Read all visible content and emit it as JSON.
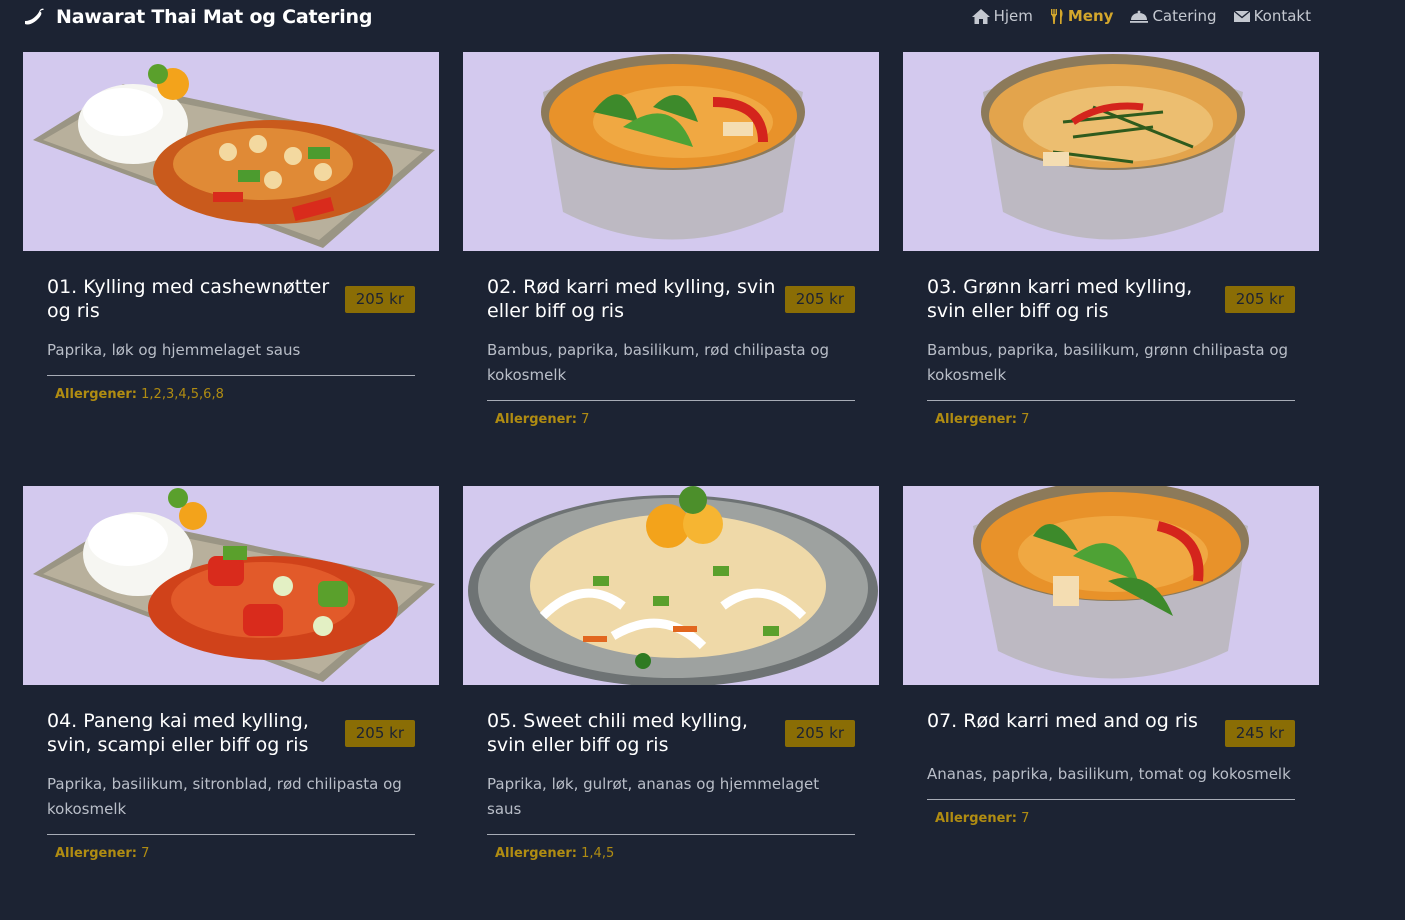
{
  "brand": {
    "name": "Nawarat Thai Mat og Catering",
    "icon": "chili-pepper-icon"
  },
  "nav": [
    {
      "label": "Hjem",
      "icon": "home-icon",
      "active": false
    },
    {
      "label": "Meny",
      "icon": "utensils-icon",
      "active": true
    },
    {
      "label": "Catering",
      "icon": "cloche-icon",
      "active": false
    },
    {
      "label": "Kontakt",
      "icon": "envelope-icon",
      "active": false
    }
  ],
  "allergen_label": "Allergener:",
  "colors": {
    "background": "#1c2333",
    "accent": "#d4a72c",
    "badge": "#8a6d05"
  },
  "menu": [
    {
      "name": "01. Kylling med cashewnøtter og ris",
      "price": "205 kr",
      "description": "Paprika, løk og hjemmelaget saus",
      "allergens": "1,2,3,4,5,6,8",
      "photo": "plate-with-rice-and-cashew-chicken"
    },
    {
      "name": "02. Rød karri med kylling, svin eller biff og ris",
      "price": "205 kr",
      "description": "Bambus, paprika, basilikum, rød chilipasta og kokosmelk",
      "allergens": "7",
      "photo": "bowl-of-red-curry"
    },
    {
      "name": "03. Grønn karri med kylling, svin eller biff og ris",
      "price": "205 kr",
      "description": "Bambus, paprika, basilikum, grønn chilipasta og kokosmelk",
      "allergens": "7",
      "photo": "bowl-of-green-curry"
    },
    {
      "name": "04. Paneng kai med kylling, svin, scampi eller biff og ris",
      "price": "205 kr",
      "description": "Paprika, basilikum, sitronblad, rød chilipasta og kokosmelk",
      "allergens": "7",
      "photo": "plate-with-rice-and-paneng-curry"
    },
    {
      "name": "05. Sweet chili med kylling, svin eller biff og ris",
      "price": "205 kr",
      "description": "Paprika, løk, gulrøt, ananas og hjemmelaget saus",
      "allergens": "1,4,5",
      "photo": "plate-of-fried-rice"
    },
    {
      "name": "07. Rød karri med and og ris",
      "price": "245 kr",
      "description": "Ananas, paprika, basilikum, tomat og kokosmelk",
      "allergens": "7",
      "photo": "bowl-of-red-curry-with-duck"
    }
  ]
}
